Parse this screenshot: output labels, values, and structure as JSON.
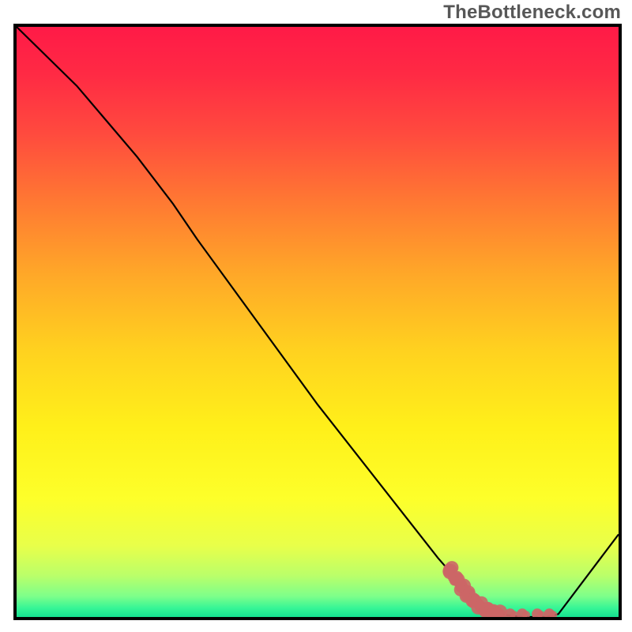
{
  "attribution": "TheBottleneck.com",
  "chart_data": {
    "type": "line",
    "title": "",
    "xlabel": "",
    "ylabel": "",
    "xlim": [
      0,
      100
    ],
    "ylim": [
      0,
      100
    ],
    "series": [
      {
        "name": "bottleneck-curve",
        "x": [
          0,
          10,
          20,
          26,
          30,
          40,
          50,
          60,
          70,
          76,
          80,
          84,
          88,
          90,
          100
        ],
        "y": [
          100,
          90,
          78,
          70,
          64,
          50,
          36,
          23,
          10,
          3,
          0.5,
          0,
          0,
          0.5,
          14
        ]
      }
    ],
    "highlight": {
      "name": "optimal-region",
      "color": "#cc6666",
      "points": [
        {
          "x": 72.0,
          "y": 8.0
        },
        {
          "x": 73.0,
          "y": 6.5
        },
        {
          "x": 74.0,
          "y": 5.0
        },
        {
          "x": 75.0,
          "y": 3.8
        },
        {
          "x": 76.0,
          "y": 2.8
        },
        {
          "x": 77.0,
          "y": 2.0
        },
        {
          "x": 78.0,
          "y": 1.3
        },
        {
          "x": 79.0,
          "y": 0.8
        },
        {
          "x": 80.0,
          "y": 0.5
        },
        {
          "x": 82.0,
          "y": 0.5
        },
        {
          "x": 84.0,
          "y": 0.5
        },
        {
          "x": 86.5,
          "y": 0.5
        },
        {
          "x": 88.5,
          "y": 0.5
        }
      ]
    },
    "gradient_stops": [
      {
        "offset": 0.0,
        "color": "#ff1a47"
      },
      {
        "offset": 0.08,
        "color": "#ff2a44"
      },
      {
        "offset": 0.18,
        "color": "#ff4a3e"
      },
      {
        "offset": 0.3,
        "color": "#ff7a32"
      },
      {
        "offset": 0.42,
        "color": "#ffa828"
      },
      {
        "offset": 0.55,
        "color": "#ffd21f"
      },
      {
        "offset": 0.68,
        "color": "#fff01a"
      },
      {
        "offset": 0.8,
        "color": "#fdff2a"
      },
      {
        "offset": 0.88,
        "color": "#e8ff4a"
      },
      {
        "offset": 0.93,
        "color": "#baff6a"
      },
      {
        "offset": 0.965,
        "color": "#7dff8a"
      },
      {
        "offset": 0.985,
        "color": "#36f596"
      },
      {
        "offset": 1.0,
        "color": "#14e090"
      }
    ]
  }
}
